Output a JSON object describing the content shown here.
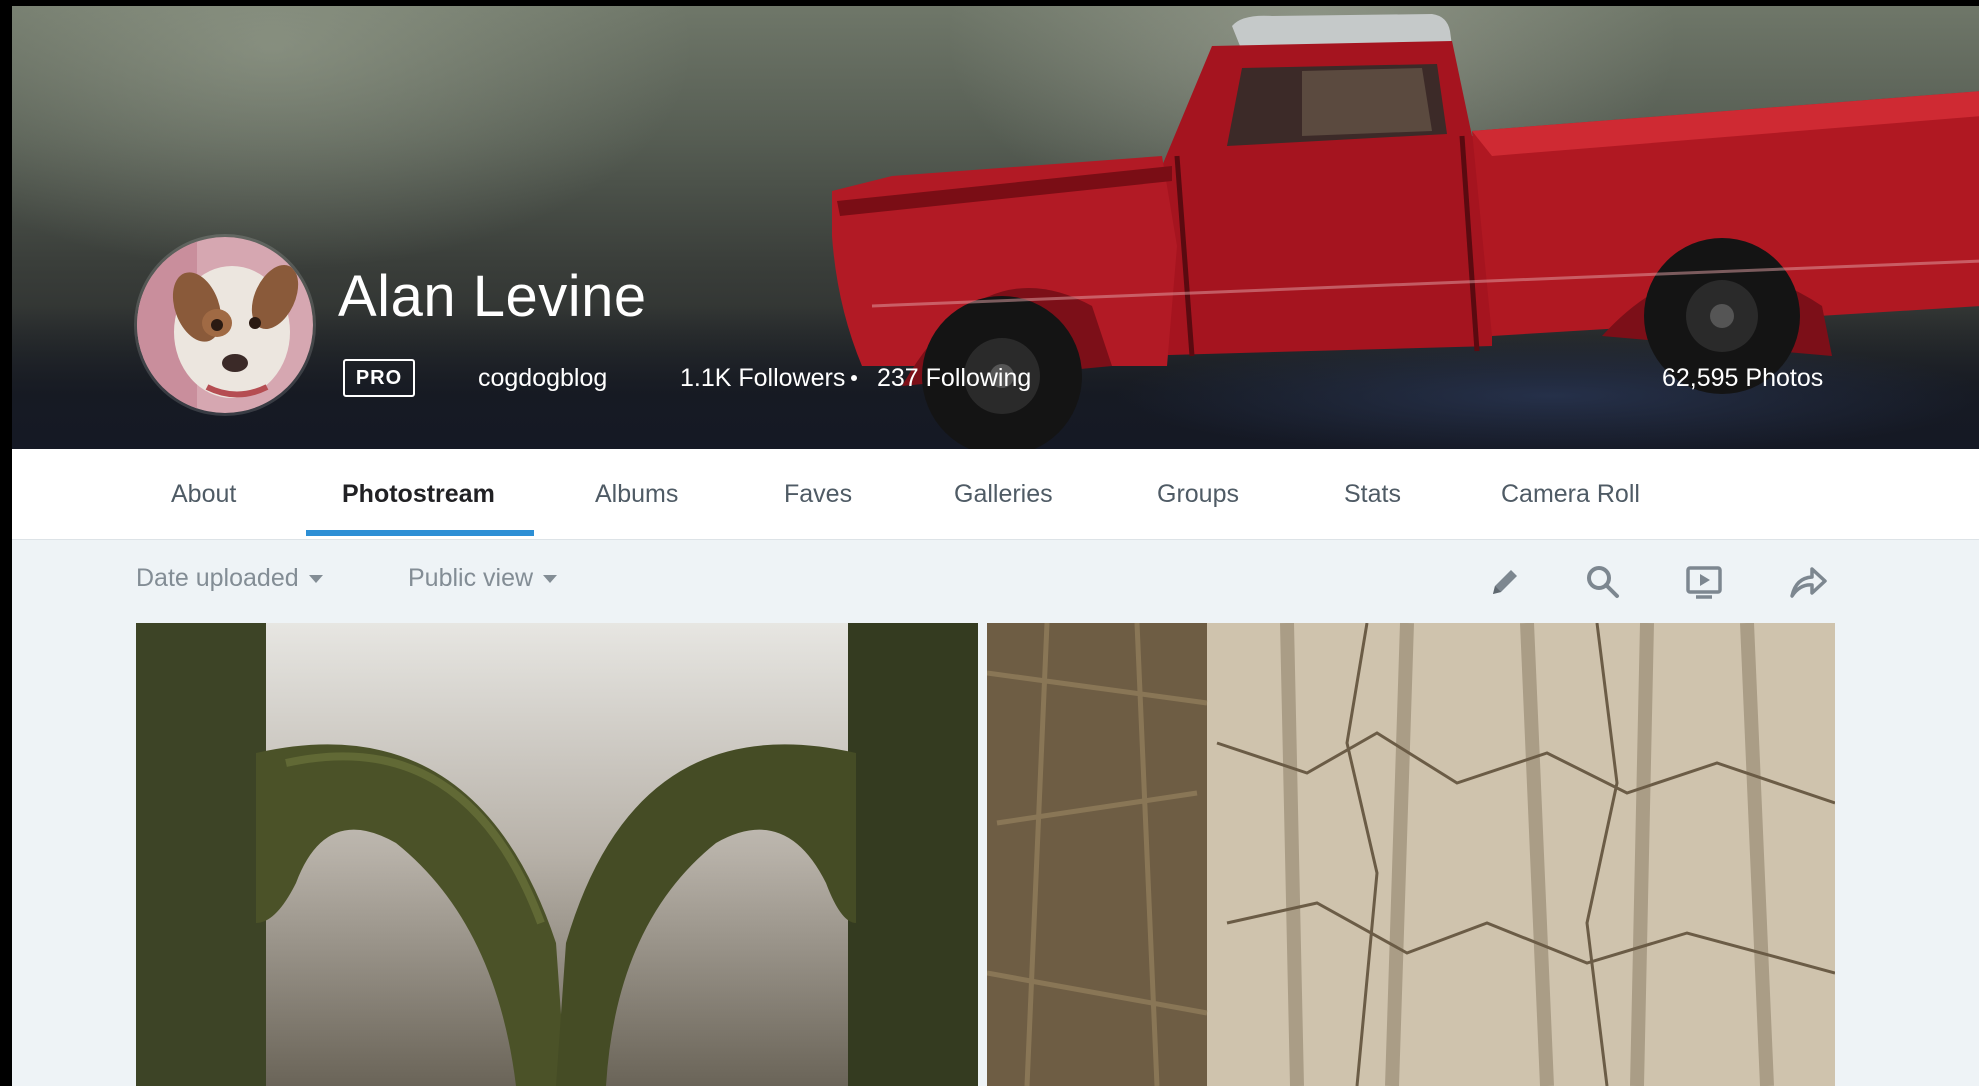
{
  "profile": {
    "name": "Alan Levine",
    "badge": "PRO",
    "username": "cogdogblog",
    "followers": "1.1K Followers",
    "following": "237 Following",
    "photo_count": "62,595 Photos"
  },
  "nav": {
    "tabs": [
      {
        "label": "About"
      },
      {
        "label": "Photostream",
        "active": true
      },
      {
        "label": "Albums"
      },
      {
        "label": "Faves"
      },
      {
        "label": "Galleries"
      },
      {
        "label": "Groups"
      },
      {
        "label": "Stats"
      },
      {
        "label": "Camera Roll"
      }
    ]
  },
  "toolbar": {
    "sort": "Date uploaded",
    "view": "Public view",
    "icons": [
      "edit-pencil-icon",
      "search-icon",
      "slideshow-icon",
      "share-icon"
    ]
  },
  "photos": [
    {
      "subject": "two green mugs with touching handles"
    },
    {
      "subject": "cracked dry mud and grass"
    }
  ],
  "colors": {
    "accent": "#2d8fd5",
    "page_bg": "#eef3f6",
    "nav_text": "#4f5b65",
    "toolbar_text": "#838d95"
  }
}
